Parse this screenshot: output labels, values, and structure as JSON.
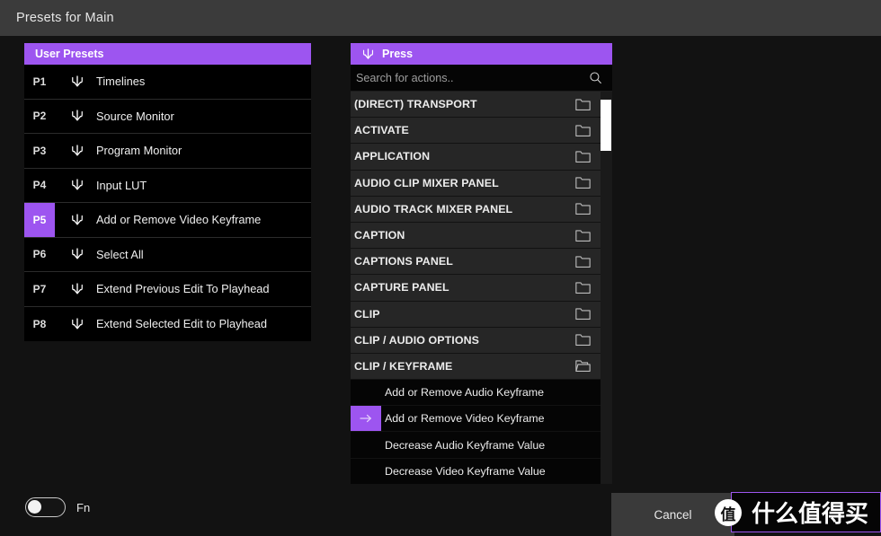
{
  "window": {
    "title": "Presets for Main"
  },
  "presets_panel": {
    "header": "User Presets",
    "rows": [
      {
        "key": "P1",
        "label": "Timelines",
        "selected": false,
        "icon": "press-down-icon"
      },
      {
        "key": "P2",
        "label": "Source Monitor",
        "selected": false,
        "icon": "press-down-icon"
      },
      {
        "key": "P3",
        "label": "Program Monitor",
        "selected": false,
        "icon": "press-down-icon"
      },
      {
        "key": "P4",
        "label": "Input LUT",
        "selected": false,
        "icon": "press-down-icon"
      },
      {
        "key": "P5",
        "label": "Add or Remove Video Keyframe",
        "selected": true,
        "icon": "press-down-icon"
      },
      {
        "key": "P6",
        "label": "Select All",
        "selected": false,
        "icon": "press-down-icon"
      },
      {
        "key": "P7",
        "label": "Extend Previous Edit To Playhead",
        "selected": false,
        "icon": "press-down-icon"
      },
      {
        "key": "P8",
        "label": "Extend Selected Edit to Playhead",
        "selected": false,
        "icon": "press-down-icon"
      }
    ]
  },
  "actions_panel": {
    "header": "Press",
    "header_icon": "press-down-icon",
    "search": {
      "placeholder": "Search for actions..",
      "value": "",
      "icon": "search-icon"
    },
    "rows": [
      {
        "label": "(DIRECT) TRANSPORT",
        "type": "folder",
        "open": false,
        "selected": false
      },
      {
        "label": "ACTIVATE",
        "type": "folder",
        "open": false,
        "selected": false
      },
      {
        "label": "APPLICATION",
        "type": "folder",
        "open": false,
        "selected": false
      },
      {
        "label": "AUDIO CLIP MIXER PANEL",
        "type": "folder",
        "open": false,
        "selected": false
      },
      {
        "label": "AUDIO TRACK MIXER PANEL",
        "type": "folder",
        "open": false,
        "selected": false
      },
      {
        "label": "CAPTION",
        "type": "folder",
        "open": false,
        "selected": false
      },
      {
        "label": "CAPTIONS PANEL",
        "type": "folder",
        "open": false,
        "selected": false
      },
      {
        "label": "CAPTURE PANEL",
        "type": "folder",
        "open": false,
        "selected": false
      },
      {
        "label": "CLIP",
        "type": "folder",
        "open": false,
        "selected": false
      },
      {
        "label": "CLIP / AUDIO OPTIONS",
        "type": "folder",
        "open": false,
        "selected": false
      },
      {
        "label": "CLIP / KEYFRAME",
        "type": "folder",
        "open": true,
        "selected": false
      },
      {
        "label": "Add or Remove Audio Keyframe",
        "type": "child",
        "open": false,
        "selected": false
      },
      {
        "label": "Add or Remove Video Keyframe",
        "type": "child",
        "open": false,
        "selected": true
      },
      {
        "label": "Decrease Audio Keyframe Value",
        "type": "child",
        "open": false,
        "selected": false
      },
      {
        "label": "Decrease Video Keyframe Value",
        "type": "child",
        "open": false,
        "selected": false
      }
    ],
    "scrollbar": {
      "thumb_position_percent": 2,
      "thumb_size_percent": 13
    }
  },
  "footer": {
    "fn_toggle": {
      "label": "Fn",
      "enabled": false
    },
    "cancel_label": "Cancel"
  },
  "watermark": {
    "logo_char": "值",
    "text": "什么值得买"
  },
  "colors": {
    "accent_purple": "#9d55f0",
    "titlebar_bg": "#3b3b3b",
    "page_bg": "#121212",
    "row_bg": "#262626",
    "child_row_bg": "#050505"
  }
}
